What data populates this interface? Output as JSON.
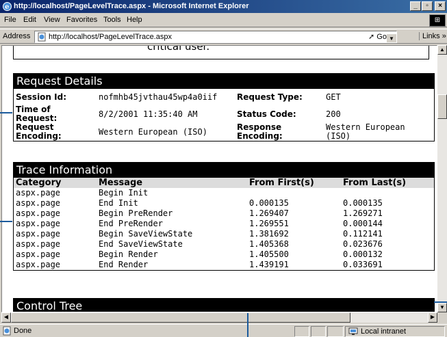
{
  "window": {
    "title": "http://localhost/PageLevelTrace.aspx - Microsoft Internet Explorer",
    "buttons": {
      "minimize": "_",
      "maximize": "▫",
      "close": "×"
    }
  },
  "menu": [
    "File",
    "Edit",
    "View",
    "Favorites",
    "Tools",
    "Help"
  ],
  "address": {
    "label": "Address",
    "url": "http://localhost/PageLevelTrace.aspx",
    "go": "Go",
    "links": "Links »"
  },
  "page": {
    "prev_text": "critical user.",
    "request_details": {
      "heading": "Request Details",
      "rows": [
        {
          "l1": "Session Id:",
          "v1": "nofmhb45jvthau45wp4a0iif",
          "l2": "Request Type:",
          "v2": "GET"
        },
        {
          "l1": "Time of Request:",
          "v1": "8/2/2001 11:35:40 AM",
          "l2": "Status Code:",
          "v2": "200"
        },
        {
          "l1": "Request Encoding:",
          "v1": "Western European (ISO)",
          "l2": "Response Encoding:",
          "v2": "Western European (ISO)"
        }
      ]
    },
    "trace_info": {
      "heading": "Trace Information",
      "columns": [
        "Category",
        "Message",
        "From First(s)",
        "From Last(s)"
      ],
      "rows": [
        [
          "aspx.page",
          "Begin Init",
          "",
          ""
        ],
        [
          "aspx.page",
          "End Init",
          "0.000135",
          "0.000135"
        ],
        [
          "aspx.page",
          "Begin PreRender",
          "1.269407",
          "1.269271"
        ],
        [
          "aspx.page",
          "End PreRender",
          "1.269551",
          "0.000144"
        ],
        [
          "aspx.page",
          "Begin SaveViewState",
          "1.381692",
          "0.112141"
        ],
        [
          "aspx.page",
          "End SaveViewState",
          "1.405368",
          "0.023676"
        ],
        [
          "aspx.page",
          "Begin Render",
          "1.405500",
          "0.000132"
        ],
        [
          "aspx.page",
          "End Render",
          "1.439191",
          "0.033691"
        ]
      ]
    },
    "control_tree": {
      "heading": "Control Tree"
    }
  },
  "status": {
    "text": "Done",
    "zone": "Local intranet"
  },
  "colors": {
    "callout": "#1a5a9c",
    "title_start": "#0a246a",
    "title_end": "#3a6ea5"
  }
}
